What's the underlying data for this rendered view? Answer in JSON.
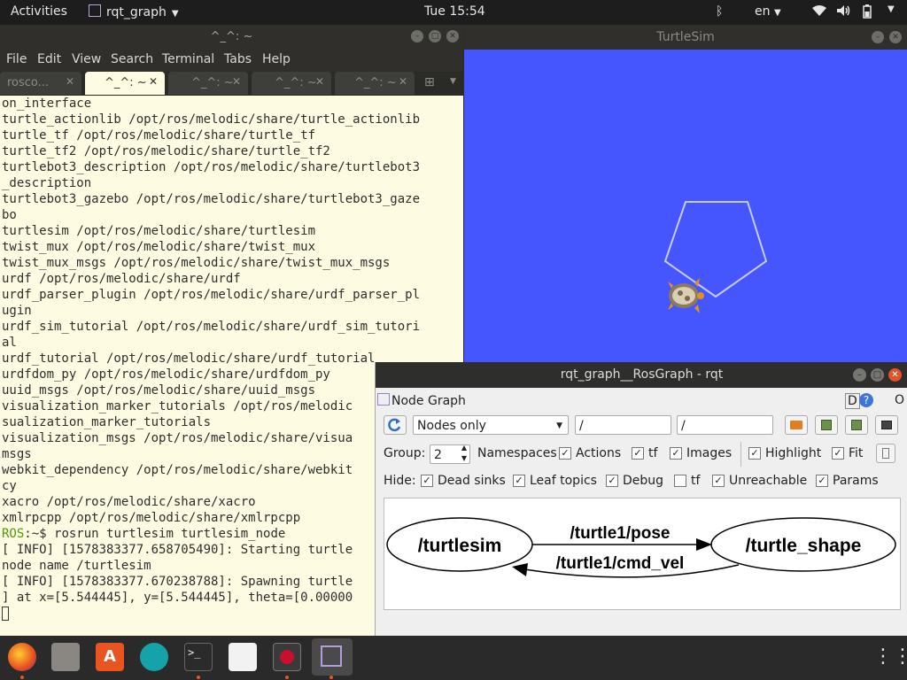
{
  "topbar": {
    "activities": "Activities",
    "app_name": "rqt_graph",
    "clock": "Tue 15:54",
    "language": "en"
  },
  "terminal": {
    "title": "^_^: ~",
    "menu": [
      "File",
      "Edit",
      "View",
      "Search",
      "Terminal",
      "Tabs",
      "Help"
    ],
    "tabs": [
      "rosco...",
      "^_^: ~",
      "^_^: ~",
      "^_^: ~",
      "^_^: ~"
    ],
    "active_tab_index": 1,
    "lines": [
      "on_interface",
      "turtle_actionlib /opt/ros/melodic/share/turtle_actionlib",
      "turtle_tf /opt/ros/melodic/share/turtle_tf",
      "turtle_tf2 /opt/ros/melodic/share/turtle_tf2",
      "turtlebot3_description /opt/ros/melodic/share/turtlebot3",
      "_description",
      "turtlebot3_gazebo /opt/ros/melodic/share/turtlebot3_gaze",
      "bo",
      "turtlesim /opt/ros/melodic/share/turtlesim",
      "twist_mux /opt/ros/melodic/share/twist_mux",
      "twist_mux_msgs /opt/ros/melodic/share/twist_mux_msgs",
      "urdf /opt/ros/melodic/share/urdf",
      "urdf_parser_plugin /opt/ros/melodic/share/urdf_parser_pl",
      "ugin",
      "urdf_sim_tutorial /opt/ros/melodic/share/urdf_sim_tutori",
      "al",
      "urdf_tutorial /opt/ros/melodic/share/urdf_tutorial",
      "urdfdom_py /opt/ros/melodic/share/urdfdom_py",
      "uuid_msgs /opt/ros/melodic/share/uuid_msgs",
      "visualization_marker_tutorials /opt/ros/melodic",
      "sualization_marker_tutorials",
      "visualization_msgs /opt/ros/melodic/share/visua",
      "msgs",
      "webkit_dependency /opt/ros/melodic/share/webkit",
      "cy",
      "xacro /opt/ros/melodic/share/xacro",
      "xmlrpcpp /opt/ros/melodic/share/xmlrpcpp"
    ],
    "prompt_user": "ROS",
    "prompt_rest": ":~$ rosrun turtlesim turtlesim_node",
    "log_lines": [
      "[ INFO] [1578383377.658705490]: Starting turtle",
      "node name /turtlesim",
      "[ INFO] [1578383377.670238788]: Spawning turtle",
      "] at x=[5.544445], y=[5.544445], theta=[0.00000"
    ]
  },
  "turtlesim": {
    "title": "TurtleSim",
    "background": "#4556ff"
  },
  "rqt": {
    "title": "rqt_graph__RosGraph - rqt",
    "plugin_label": "Node Graph",
    "plugin_right": "D",
    "plugin_right2": "O",
    "mode": "Nodes only",
    "ns_filter": "/",
    "topic_filter": "/",
    "group_label": "Group:",
    "group_value": "2",
    "row1": {
      "namespaces": "Namespaces",
      "actions": "Actions",
      "tf": "tf",
      "images": "Images",
      "highlight": "Highlight",
      "fit": "Fit"
    },
    "hide_label": "Hide:",
    "row2": {
      "dead_sinks": "Dead sinks",
      "leaf_topics": "Leaf topics",
      "debug": "Debug",
      "tf": "tf",
      "unreachable": "Unreachable",
      "params": "Params"
    },
    "graph": {
      "node_a": "/turtlesim",
      "node_b": "/turtle_shape",
      "edge_ab": "/turtle1/pose",
      "edge_ba": "/turtle1/cmd_vel"
    }
  },
  "dock": {
    "items": [
      "firefox-icon",
      "files-icon",
      "software-icon",
      "arduino-icon",
      "terminal-icon",
      "text-editor-icon",
      "rviz-icon",
      "rqt-icon",
      "show-apps-icon"
    ]
  }
}
